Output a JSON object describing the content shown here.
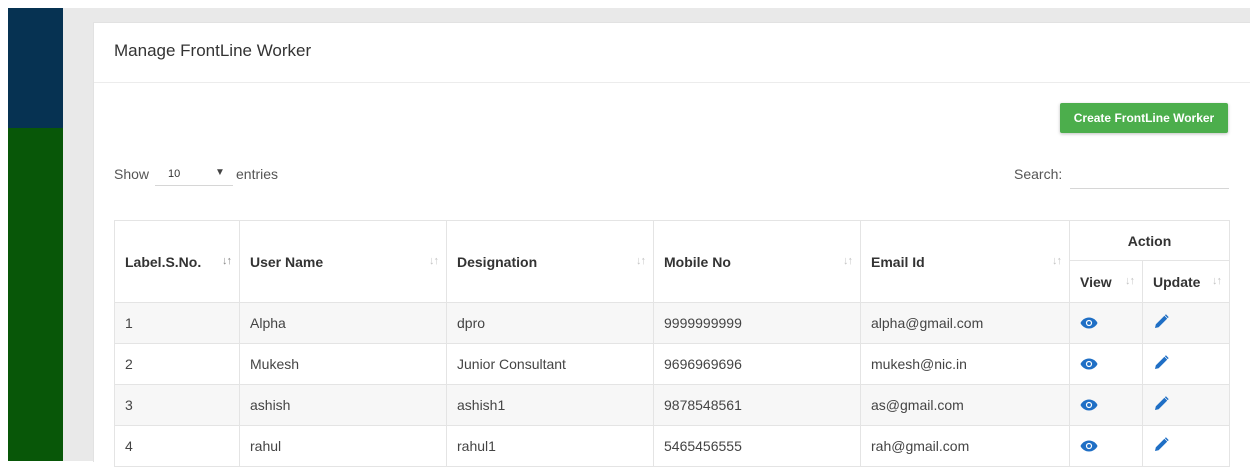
{
  "page": {
    "title": "Manage FrontLine Worker",
    "create_button": "Create FrontLine Worker"
  },
  "length_control": {
    "show_label": "Show",
    "selected": "10",
    "entries_label": "entries"
  },
  "search": {
    "label": "Search:",
    "value": ""
  },
  "table": {
    "action_group": "Action",
    "columns": {
      "sno": "Label.S.No.",
      "user_name": "User Name",
      "designation": "Designation",
      "mobile": "Mobile No",
      "email": "Email Id",
      "view": "View",
      "update": "Update"
    },
    "rows": [
      {
        "sno": "1",
        "user_name": "Alpha",
        "designation": "dpro",
        "mobile": "9999999999",
        "email": "alpha@gmail.com"
      },
      {
        "sno": "2",
        "user_name": "Mukesh",
        "designation": "Junior Consultant",
        "mobile": "9696969696",
        "email": "mukesh@nic.in"
      },
      {
        "sno": "3",
        "user_name": "ashish",
        "designation": "ashish1",
        "mobile": "9878548561",
        "email": "as@gmail.com"
      },
      {
        "sno": "4",
        "user_name": "rahul",
        "designation": "rahul1",
        "mobile": "5465456555",
        "email": "rah@gmail.com"
      }
    ]
  },
  "icons": {
    "view": "eye-icon",
    "update": "pencil-icon",
    "sort": "sort-icon"
  },
  "colors": {
    "sidebar_top": "#063252",
    "sidebar_bottom": "#085708",
    "button": "#4cae4c",
    "icon": "#1f6fc5"
  }
}
